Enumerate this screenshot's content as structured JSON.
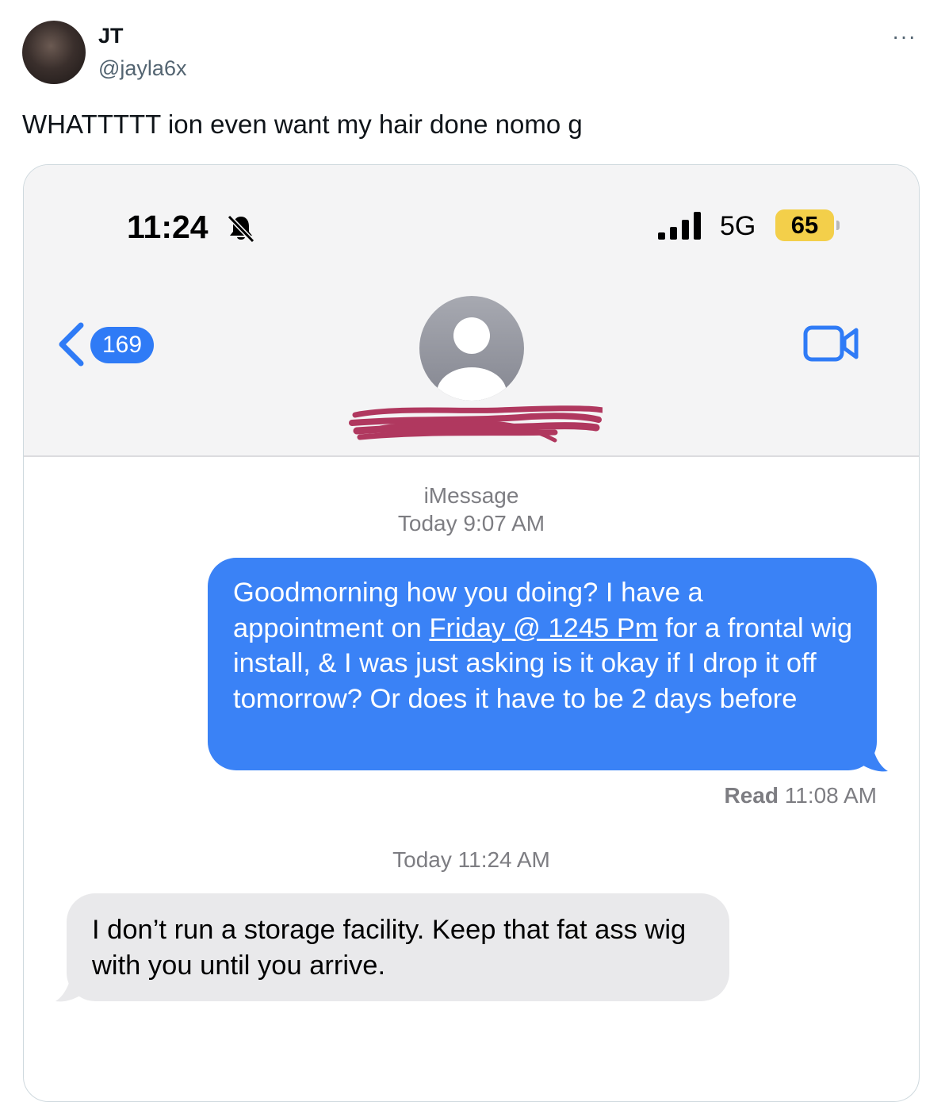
{
  "tweet": {
    "author_name": "JT",
    "author_handle": "@jayla6x",
    "more_label": "···",
    "text": "WHATTTTT ion even want my hair done nomo g"
  },
  "status_bar": {
    "time": "11:24",
    "network": "5G",
    "battery": "65"
  },
  "nav": {
    "back_count": "169"
  },
  "conversation": {
    "service": "iMessage",
    "first_timestamp": "Today 9:07 AM",
    "outgoing_message": {
      "part1": "Goodmorning how you doing? I have a appointment on ",
      "link": "Friday @ 1245 Pm",
      "part2": " for a frontal wig install, & I was just asking is it okay if I drop it off tomorrow? Or does it have to be 2 days before"
    },
    "read_label": "Read",
    "read_time": "11:08 AM",
    "second_timestamp": "Today 11:24 AM",
    "incoming_message": "I don’t run a storage facility. Keep that fat ass wig with you until you arrive."
  },
  "colors": {
    "imessage_blue": "#3a82f6",
    "incoming_gray": "#e9e9eb",
    "badge_blue": "#2f7bf6",
    "battery_yellow": "#f3cf4a",
    "redaction": "#b0385f"
  },
  "icons": [
    "profile-avatar",
    "more-icon",
    "bell-slash-icon",
    "signal-icon",
    "battery-icon",
    "chevron-left-icon",
    "contact-avatar-icon",
    "video-camera-icon"
  ]
}
